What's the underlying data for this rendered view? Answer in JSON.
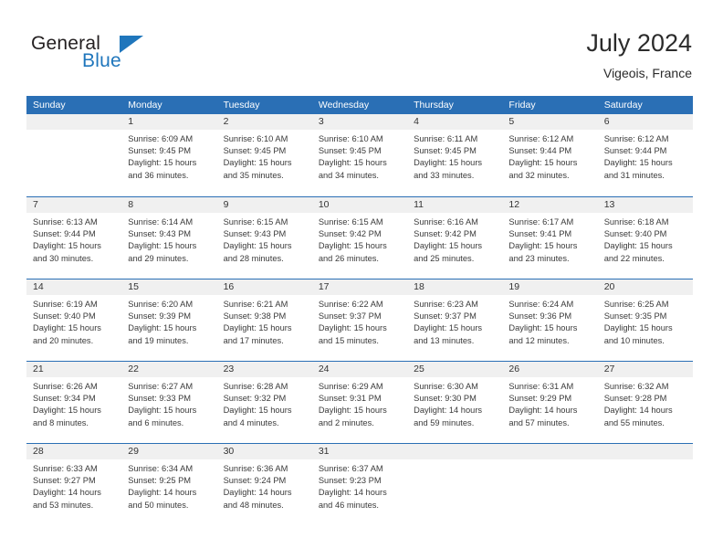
{
  "brand": {
    "name_part1": "General",
    "name_part2": "Blue",
    "accent_color": "#1f76bc"
  },
  "header": {
    "title": "July 2024",
    "subtitle": "Vigeois, France"
  },
  "theme": {
    "header_blue": "#2a6fb5",
    "day_band_gray": "#f0f0f0"
  },
  "weekdays": [
    "Sunday",
    "Monday",
    "Tuesday",
    "Wednesday",
    "Thursday",
    "Friday",
    "Saturday"
  ],
  "weeks": [
    [
      {
        "day": "",
        "sunrise": "",
        "sunset": "",
        "daylight_line1": "",
        "daylight_line2": ""
      },
      {
        "day": "1",
        "sunrise": "Sunrise: 6:09 AM",
        "sunset": "Sunset: 9:45 PM",
        "daylight_line1": "Daylight: 15 hours",
        "daylight_line2": "and 36 minutes."
      },
      {
        "day": "2",
        "sunrise": "Sunrise: 6:10 AM",
        "sunset": "Sunset: 9:45 PM",
        "daylight_line1": "Daylight: 15 hours",
        "daylight_line2": "and 35 minutes."
      },
      {
        "day": "3",
        "sunrise": "Sunrise: 6:10 AM",
        "sunset": "Sunset: 9:45 PM",
        "daylight_line1": "Daylight: 15 hours",
        "daylight_line2": "and 34 minutes."
      },
      {
        "day": "4",
        "sunrise": "Sunrise: 6:11 AM",
        "sunset": "Sunset: 9:45 PM",
        "daylight_line1": "Daylight: 15 hours",
        "daylight_line2": "and 33 minutes."
      },
      {
        "day": "5",
        "sunrise": "Sunrise: 6:12 AM",
        "sunset": "Sunset: 9:44 PM",
        "daylight_line1": "Daylight: 15 hours",
        "daylight_line2": "and 32 minutes."
      },
      {
        "day": "6",
        "sunrise": "Sunrise: 6:12 AM",
        "sunset": "Sunset: 9:44 PM",
        "daylight_line1": "Daylight: 15 hours",
        "daylight_line2": "and 31 minutes."
      }
    ],
    [
      {
        "day": "7",
        "sunrise": "Sunrise: 6:13 AM",
        "sunset": "Sunset: 9:44 PM",
        "daylight_line1": "Daylight: 15 hours",
        "daylight_line2": "and 30 minutes."
      },
      {
        "day": "8",
        "sunrise": "Sunrise: 6:14 AM",
        "sunset": "Sunset: 9:43 PM",
        "daylight_line1": "Daylight: 15 hours",
        "daylight_line2": "and 29 minutes."
      },
      {
        "day": "9",
        "sunrise": "Sunrise: 6:15 AM",
        "sunset": "Sunset: 9:43 PM",
        "daylight_line1": "Daylight: 15 hours",
        "daylight_line2": "and 28 minutes."
      },
      {
        "day": "10",
        "sunrise": "Sunrise: 6:15 AM",
        "sunset": "Sunset: 9:42 PM",
        "daylight_line1": "Daylight: 15 hours",
        "daylight_line2": "and 26 minutes."
      },
      {
        "day": "11",
        "sunrise": "Sunrise: 6:16 AM",
        "sunset": "Sunset: 9:42 PM",
        "daylight_line1": "Daylight: 15 hours",
        "daylight_line2": "and 25 minutes."
      },
      {
        "day": "12",
        "sunrise": "Sunrise: 6:17 AM",
        "sunset": "Sunset: 9:41 PM",
        "daylight_line1": "Daylight: 15 hours",
        "daylight_line2": "and 23 minutes."
      },
      {
        "day": "13",
        "sunrise": "Sunrise: 6:18 AM",
        "sunset": "Sunset: 9:40 PM",
        "daylight_line1": "Daylight: 15 hours",
        "daylight_line2": "and 22 minutes."
      }
    ],
    [
      {
        "day": "14",
        "sunrise": "Sunrise: 6:19 AM",
        "sunset": "Sunset: 9:40 PM",
        "daylight_line1": "Daylight: 15 hours",
        "daylight_line2": "and 20 minutes."
      },
      {
        "day": "15",
        "sunrise": "Sunrise: 6:20 AM",
        "sunset": "Sunset: 9:39 PM",
        "daylight_line1": "Daylight: 15 hours",
        "daylight_line2": "and 19 minutes."
      },
      {
        "day": "16",
        "sunrise": "Sunrise: 6:21 AM",
        "sunset": "Sunset: 9:38 PM",
        "daylight_line1": "Daylight: 15 hours",
        "daylight_line2": "and 17 minutes."
      },
      {
        "day": "17",
        "sunrise": "Sunrise: 6:22 AM",
        "sunset": "Sunset: 9:37 PM",
        "daylight_line1": "Daylight: 15 hours",
        "daylight_line2": "and 15 minutes."
      },
      {
        "day": "18",
        "sunrise": "Sunrise: 6:23 AM",
        "sunset": "Sunset: 9:37 PM",
        "daylight_line1": "Daylight: 15 hours",
        "daylight_line2": "and 13 minutes."
      },
      {
        "day": "19",
        "sunrise": "Sunrise: 6:24 AM",
        "sunset": "Sunset: 9:36 PM",
        "daylight_line1": "Daylight: 15 hours",
        "daylight_line2": "and 12 minutes."
      },
      {
        "day": "20",
        "sunrise": "Sunrise: 6:25 AM",
        "sunset": "Sunset: 9:35 PM",
        "daylight_line1": "Daylight: 15 hours",
        "daylight_line2": "and 10 minutes."
      }
    ],
    [
      {
        "day": "21",
        "sunrise": "Sunrise: 6:26 AM",
        "sunset": "Sunset: 9:34 PM",
        "daylight_line1": "Daylight: 15 hours",
        "daylight_line2": "and 8 minutes."
      },
      {
        "day": "22",
        "sunrise": "Sunrise: 6:27 AM",
        "sunset": "Sunset: 9:33 PM",
        "daylight_line1": "Daylight: 15 hours",
        "daylight_line2": "and 6 minutes."
      },
      {
        "day": "23",
        "sunrise": "Sunrise: 6:28 AM",
        "sunset": "Sunset: 9:32 PM",
        "daylight_line1": "Daylight: 15 hours",
        "daylight_line2": "and 4 minutes."
      },
      {
        "day": "24",
        "sunrise": "Sunrise: 6:29 AM",
        "sunset": "Sunset: 9:31 PM",
        "daylight_line1": "Daylight: 15 hours",
        "daylight_line2": "and 2 minutes."
      },
      {
        "day": "25",
        "sunrise": "Sunrise: 6:30 AM",
        "sunset": "Sunset: 9:30 PM",
        "daylight_line1": "Daylight: 14 hours",
        "daylight_line2": "and 59 minutes."
      },
      {
        "day": "26",
        "sunrise": "Sunrise: 6:31 AM",
        "sunset": "Sunset: 9:29 PM",
        "daylight_line1": "Daylight: 14 hours",
        "daylight_line2": "and 57 minutes."
      },
      {
        "day": "27",
        "sunrise": "Sunrise: 6:32 AM",
        "sunset": "Sunset: 9:28 PM",
        "daylight_line1": "Daylight: 14 hours",
        "daylight_line2": "and 55 minutes."
      }
    ],
    [
      {
        "day": "28",
        "sunrise": "Sunrise: 6:33 AM",
        "sunset": "Sunset: 9:27 PM",
        "daylight_line1": "Daylight: 14 hours",
        "daylight_line2": "and 53 minutes."
      },
      {
        "day": "29",
        "sunrise": "Sunrise: 6:34 AM",
        "sunset": "Sunset: 9:25 PM",
        "daylight_line1": "Daylight: 14 hours",
        "daylight_line2": "and 50 minutes."
      },
      {
        "day": "30",
        "sunrise": "Sunrise: 6:36 AM",
        "sunset": "Sunset: 9:24 PM",
        "daylight_line1": "Daylight: 14 hours",
        "daylight_line2": "and 48 minutes."
      },
      {
        "day": "31",
        "sunrise": "Sunrise: 6:37 AM",
        "sunset": "Sunset: 9:23 PM",
        "daylight_line1": "Daylight: 14 hours",
        "daylight_line2": "and 46 minutes."
      },
      {
        "day": "",
        "sunrise": "",
        "sunset": "",
        "daylight_line1": "",
        "daylight_line2": ""
      },
      {
        "day": "",
        "sunrise": "",
        "sunset": "",
        "daylight_line1": "",
        "daylight_line2": ""
      },
      {
        "day": "",
        "sunrise": "",
        "sunset": "",
        "daylight_line1": "",
        "daylight_line2": ""
      }
    ]
  ]
}
